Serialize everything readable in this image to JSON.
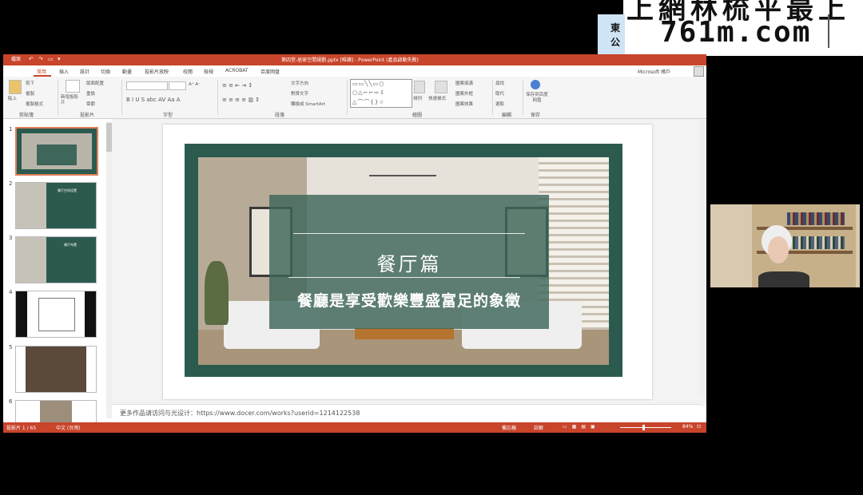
{
  "watermark": {
    "top_text": "上網林梳平最上",
    "domain": "761m.com",
    "side_text": "東公"
  },
  "window": {
    "title": "第四堂-居家空間規劃.pptx [唯讀] - PowerPoint (產品啟動失敗)"
  },
  "tabs": [
    "檔案",
    "常用",
    "插入",
    "設計",
    "切換",
    "動畫",
    "投影片放映",
    "校閱",
    "檢視",
    "ACROBAT",
    "百度网盘"
  ],
  "account": "Microsoft 帳戶",
  "ribbon": {
    "groups": [
      "剪貼簿",
      "投影片",
      "字型",
      "段落",
      "繪圖",
      "編輯",
      "保存"
    ],
    "paste": "貼上",
    "cut": "剪下",
    "copy": "複製",
    "format_painter": "複製格式",
    "new_slide": "新增投影片",
    "layout": "版面配置",
    "reset": "重設",
    "section": "章節",
    "text_direction": "文字方向",
    "align_text": "對齊文字",
    "smartart": "轉換成 SmartArt",
    "arrange": "排列",
    "quick_styles": "快速樣式",
    "shape_fill": "圖案填滿",
    "shape_outline": "圖案外框",
    "shape_effects": "圖案效果",
    "find": "尋找",
    "replace": "取代",
    "select": "選取",
    "save_baidu": "保存到百度网盘"
  },
  "thumbnails": [
    "1",
    "2",
    "3",
    "4",
    "5",
    "6"
  ],
  "slide": {
    "title": "餐厅篇",
    "subtitle": "餐廳是享受歡樂豐盛富足的象徵"
  },
  "thumb2": {
    "title": "餐厅空间设置"
  },
  "thumb3": {
    "title": "餐厅布置"
  },
  "notes": "更多作品请访问与光设计：https://www.docer.com/works?userid=1214122538",
  "status": {
    "slide": "投影片 1 / 65",
    "lang": "中文 (台灣)",
    "notes": "備忘稿",
    "comments": "註解",
    "zoom": "84%"
  },
  "colors": {
    "accent": "#c8442a",
    "slide_green": "#2c5a4f"
  }
}
